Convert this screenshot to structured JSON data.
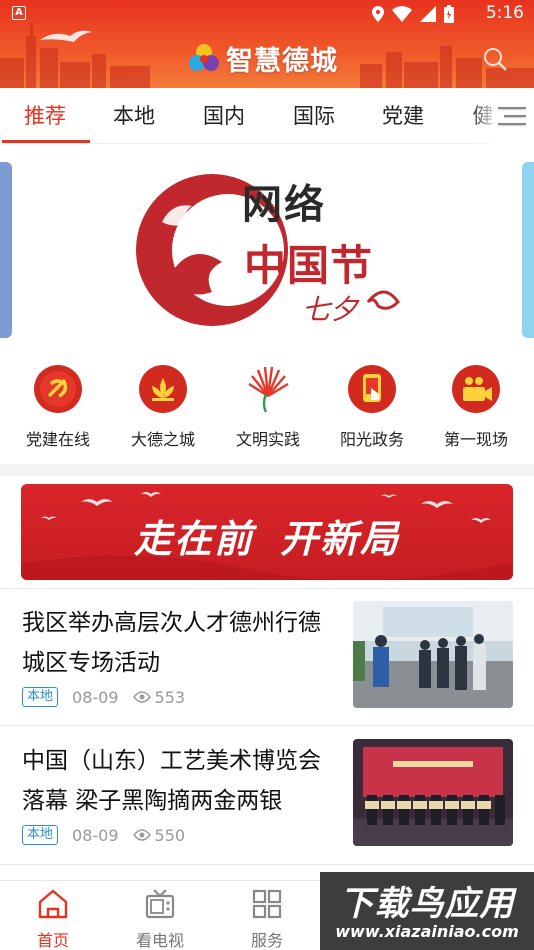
{
  "status_bar": {
    "indicator": "A",
    "time": "5:16",
    "icons": [
      "location-icon",
      "wifi-icon",
      "signal-icon",
      "battery-icon"
    ]
  },
  "header": {
    "app_name": "智慧德城",
    "colors": {
      "primary": "#e8321f",
      "gradient_end": "#f47a3a"
    }
  },
  "tabs": {
    "items": [
      {
        "label": "推荐",
        "active": true
      },
      {
        "label": "本地"
      },
      {
        "label": "国内"
      },
      {
        "label": "国际"
      },
      {
        "label": "党建"
      },
      {
        "label": "健"
      }
    ]
  },
  "banner": {
    "line1": "网络",
    "line2": "中国节",
    "line3": "七夕"
  },
  "quick_links": [
    {
      "label": "党建在线",
      "icon": "party-emblem-icon"
    },
    {
      "label": "大德之城",
      "icon": "lotus-icon"
    },
    {
      "label": "文明实践",
      "icon": "flame-fan-icon"
    },
    {
      "label": "阳光政务",
      "icon": "hand-tap-icon"
    },
    {
      "label": "第一现场",
      "icon": "video-camera-icon"
    }
  ],
  "slogan": {
    "part1": "走在前",
    "part2": "开新局"
  },
  "news": [
    {
      "title": "我区举办高层次人才德州行德城区专场活动",
      "tag": "本地",
      "date": "08-09",
      "views": "553"
    },
    {
      "title": "中国（山东）工艺美术博览会落幕 梁子黑陶摘两金两银",
      "tag": "本地",
      "date": "08-09",
      "views": "550"
    }
  ],
  "bottom_nav": [
    {
      "label": "首页",
      "icon": "home-icon",
      "active": true
    },
    {
      "label": "看电视",
      "icon": "tv-icon"
    },
    {
      "label": "服务",
      "icon": "grid-icon"
    }
  ],
  "watermark": {
    "big": "下载鸟应用",
    "small": "www.xiazainiao.com"
  }
}
